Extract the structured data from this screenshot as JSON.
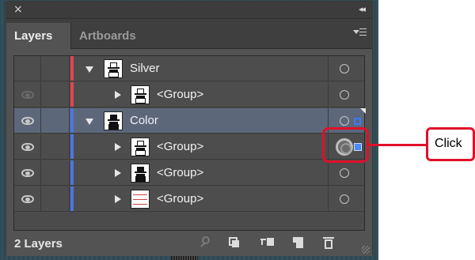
{
  "window": {
    "close_glyph": "×",
    "collapse_glyph": "◂◂"
  },
  "tabs": [
    {
      "label": "Layers",
      "active": true
    },
    {
      "label": "Artboards",
      "active": false
    }
  ],
  "layers": [
    {
      "name": "Silver",
      "level": 0,
      "expanded": true,
      "visible": false,
      "color": "#e0464c",
      "thumb": "outline-figure",
      "selected": false,
      "target": "empty"
    },
    {
      "name": "<Group>",
      "level": 1,
      "expanded": false,
      "visible": false,
      "color": "#e0464c",
      "thumb": "outline-figure",
      "selected": false,
      "target": "empty"
    },
    {
      "name": "Color",
      "level": 0,
      "expanded": true,
      "visible": true,
      "color": "#4a76e0",
      "thumb": "solid-figure",
      "selected": true,
      "target": "empty-with-selection"
    },
    {
      "name": "<Group>",
      "level": 1,
      "expanded": false,
      "visible": true,
      "color": "#4a76e0",
      "thumb": "outline-figure",
      "selected": false,
      "target": "targeted-with-selection"
    },
    {
      "name": "<Group>",
      "level": 1,
      "expanded": false,
      "visible": true,
      "color": "#4a76e0",
      "thumb": "solid-figure",
      "selected": false,
      "target": "empty"
    },
    {
      "name": "<Group>",
      "level": 1,
      "expanded": false,
      "visible": true,
      "color": "#4a76e0",
      "thumb": "red-lines",
      "selected": false,
      "target": "empty"
    }
  ],
  "footer": {
    "layer_count": "2 Layers",
    "icons": [
      "search-icon",
      "clipping-mask-icon",
      "new-sublayer-icon",
      "new-layer-icon",
      "trash-icon"
    ]
  },
  "annotation": {
    "label": "Click",
    "color": "#e0102a"
  },
  "colors": {
    "panel_bg": "#535353",
    "selected_row": "#5c677a",
    "selection_blue": "#4b8cff"
  }
}
